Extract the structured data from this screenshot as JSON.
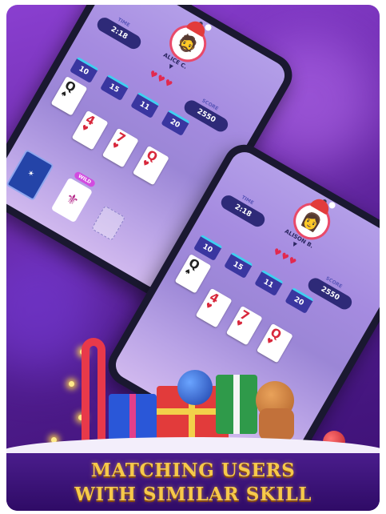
{
  "tagline": {
    "line1": "MATCHING USERS",
    "line2": "WITH SIMILAR SKILL"
  },
  "tablet_back": {
    "time_label": "TIME",
    "time": "2:18",
    "player_name": "ALICE C.",
    "score_label": "SCORE",
    "score": "2550",
    "hearts": "♥♥♥",
    "columns": [
      "10",
      "15",
      "11",
      "20"
    ],
    "cards": [
      {
        "rank": "Q",
        "suit": "♠",
        "color": "black"
      },
      {
        "rank": "4",
        "suit": "♥",
        "color": "red"
      },
      {
        "rank": "7",
        "suit": "♥",
        "color": "red"
      },
      {
        "rank": "Q",
        "suit": "♥",
        "color": "red"
      }
    ],
    "badge": "WILD"
  },
  "tablet_front": {
    "time_label": "TIME",
    "time": "2:18",
    "player_name": "ALISON B.",
    "score_label": "SCORE",
    "score": "2550",
    "hearts": "♥♥♥",
    "columns": [
      "10",
      "15",
      "11",
      "20"
    ],
    "cards": [
      {
        "rank": "Q",
        "suit": "♠",
        "color": "black"
      },
      {
        "rank": "4",
        "suit": "♥",
        "color": "red"
      },
      {
        "rank": "7",
        "suit": "♥",
        "color": "red"
      },
      {
        "rank": "Q",
        "suit": "♥",
        "color": "red"
      }
    ]
  },
  "colors": {
    "background": "#6a2aa8",
    "tagline": "#f6c94b",
    "pill": "#2e2a78",
    "hearts": "#e2294f"
  }
}
